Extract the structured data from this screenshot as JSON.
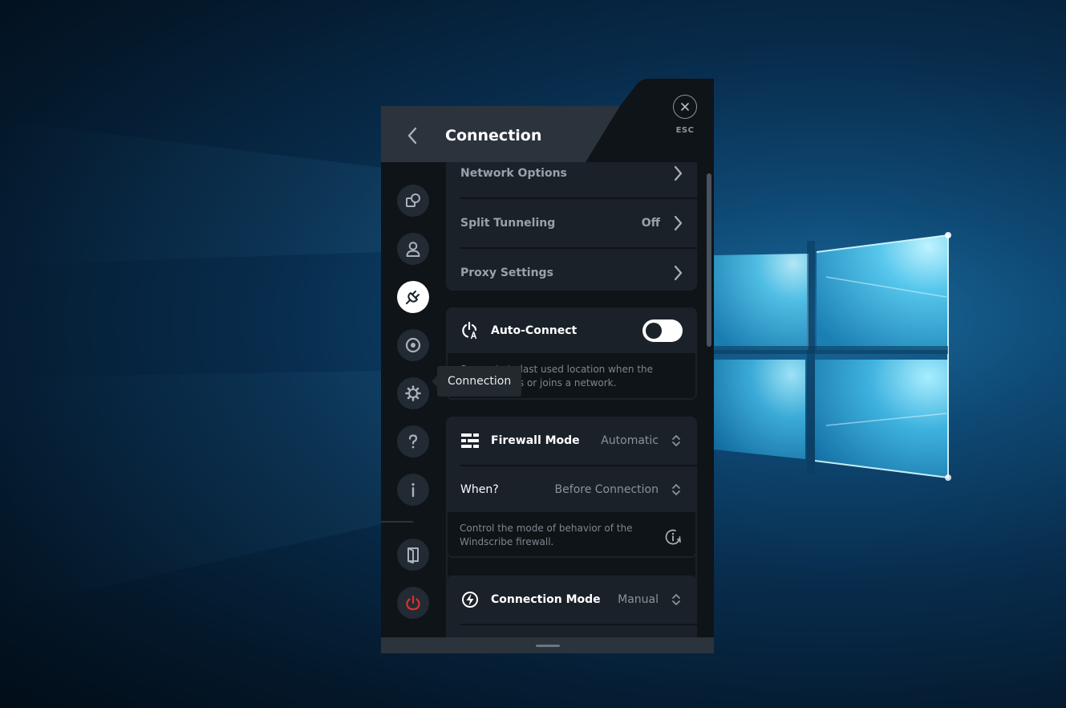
{
  "window": {
    "title": "Connection",
    "esc_label": "ESC"
  },
  "sidebar": {
    "items": [
      {
        "name": "sidebar-item-general",
        "icon": "preferences-shapes-icon",
        "active": false
      },
      {
        "name": "sidebar-item-account",
        "icon": "user-icon",
        "active": false
      },
      {
        "name": "sidebar-item-connection",
        "icon": "plug-icon",
        "active": true
      },
      {
        "name": "sidebar-item-robert",
        "icon": "target-icon",
        "active": false
      },
      {
        "name": "sidebar-item-advanced",
        "icon": "gear-icon",
        "active": false
      },
      {
        "name": "sidebar-item-help",
        "icon": "question-icon",
        "active": false
      },
      {
        "name": "sidebar-item-about",
        "icon": "info-icon",
        "active": false
      },
      {
        "name": "sidebar-item-logout",
        "icon": "door-exit-icon",
        "active": false
      },
      {
        "name": "sidebar-item-quit",
        "icon": "power-icon",
        "active": false
      }
    ],
    "tooltip": "Connection"
  },
  "network_group": {
    "network_options": {
      "label": "Network Options"
    },
    "split_tunneling": {
      "label": "Split Tunneling",
      "value": "Off"
    },
    "proxy_settings": {
      "label": "Proxy Settings"
    }
  },
  "auto_connect": {
    "label": "Auto-Connect",
    "enabled": true,
    "description": "Connects to last used location when the app launches or joins a network."
  },
  "firewall": {
    "label": "Firewall Mode",
    "value": "Automatic",
    "when_label": "When?",
    "when_value": "Before Connection",
    "description": "Control the mode of behavior of the Windscribe firewall."
  },
  "connection_mode": {
    "label": "Connection Mode",
    "value": "Manual"
  },
  "colors": {
    "app_bg": "#0f1419",
    "card_bg": "#1b2129",
    "header_bg": "#2b333c",
    "power_red": "#e0302b",
    "wallpaper_glow": "#7fe3ff"
  }
}
